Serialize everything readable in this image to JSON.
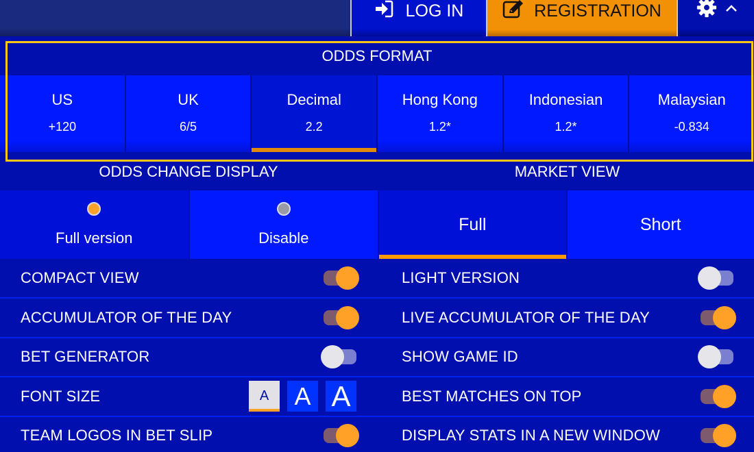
{
  "header": {
    "login_label": "LOG IN",
    "login_icon": "sign-in-icon",
    "registration_label": "REGISTRATION",
    "registration_icon": "edit-icon",
    "settings_icon": "gear-icon",
    "collapse_icon": "chevron-up-icon"
  },
  "odds_format": {
    "title": "ODDS FORMAT",
    "selected": "Decimal",
    "options": [
      {
        "name": "US",
        "value": "+120"
      },
      {
        "name": "UK",
        "value": "6/5"
      },
      {
        "name": "Decimal",
        "value": "2.2"
      },
      {
        "name": "Hong Kong",
        "value": "1.2*"
      },
      {
        "name": "Indonesian",
        "value": "1.2*"
      },
      {
        "name": "Malaysian",
        "value": "-0.834"
      }
    ]
  },
  "odds_change_display": {
    "title": "ODDS CHANGE DISPLAY",
    "selected": "Full version",
    "options": [
      {
        "label": "Full version",
        "selected": true
      },
      {
        "label": "Disable",
        "selected": false
      }
    ]
  },
  "market_view": {
    "title": "MARKET VIEW",
    "selected": "Full",
    "options": [
      {
        "label": "Full",
        "selected": true
      },
      {
        "label": "Short",
        "selected": false
      }
    ]
  },
  "settings": {
    "left": [
      {
        "label": "COMPACT VIEW",
        "enabled": true
      },
      {
        "label": "ACCUMULATOR OF THE DAY",
        "enabled": true
      },
      {
        "label": "BET GENERATOR",
        "enabled": false
      },
      {
        "label": "FONT SIZE",
        "type": "font-size",
        "options": [
          "A",
          "A",
          "A"
        ],
        "selected_index": 0
      },
      {
        "label": "TEAM LOGOS IN BET SLIP",
        "enabled": true
      }
    ],
    "right": [
      {
        "label": "LIGHT VERSION",
        "enabled": false
      },
      {
        "label": "LIVE ACCUMULATOR OF THE DAY",
        "enabled": true
      },
      {
        "label": "SHOW GAME ID",
        "enabled": false
      },
      {
        "label": "BEST MATCHES ON TOP",
        "enabled": true
      },
      {
        "label": "DISPLAY STATS IN A NEW WINDOW",
        "enabled": true
      }
    ]
  },
  "colors": {
    "background": "#000fae",
    "tile": "#0019ff",
    "accent_orange": "#f39106",
    "highlight_border": "#ffc815",
    "toggle_on_knob": "#ffa126",
    "toggle_off_knob": "#e6e6ea"
  }
}
